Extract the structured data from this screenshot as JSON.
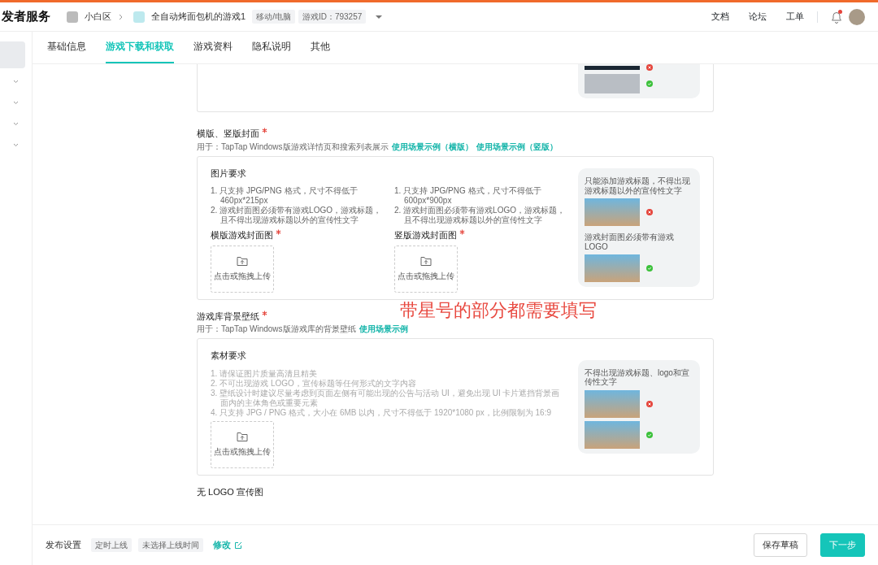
{
  "header": {
    "brand": "发者服务",
    "breadcrumb": [
      {
        "label": "小白区",
        "kind": "area"
      },
      {
        "label": "全自动烤面包机的游戏1",
        "kind": "game"
      }
    ],
    "tags": [
      "移动/电脑",
      "游戏ID：793257"
    ],
    "nav": [
      "文档",
      "论坛",
      "工单"
    ],
    "notification": true
  },
  "sidebar": {
    "items": [
      {
        "kind": "block",
        "selected": true
      },
      {
        "kind": "group",
        "selected": false
      },
      {
        "kind": "group",
        "selected": false
      },
      {
        "kind": "group",
        "selected": false
      },
      {
        "kind": "group",
        "selected": false
      }
    ]
  },
  "tabs": [
    {
      "label": "基础信息",
      "selected": false
    },
    {
      "label": "游戏下载和获取",
      "selected": true
    },
    {
      "label": "游戏资料",
      "selected": false
    },
    {
      "label": "隐私说明",
      "selected": false
    },
    {
      "label": "其他",
      "selected": false
    }
  ],
  "sections": [
    {
      "kind": "partial",
      "examples": [
        {
          "ok": false,
          "cut": true
        },
        {
          "ok": true
        }
      ]
    },
    {
      "kind": "covers",
      "title": "横版、竖版封面",
      "required": true,
      "description": "用于：TapTap Windows版游戏详情页和搜索列表展示",
      "links": [
        "使用场景示例（横版）",
        "使用场景示例（竖版）"
      ],
      "heading": "图片要求",
      "columns": [
        {
          "rules": [
            "1. 只支持 JPG/PNG 格式，尺寸不得低于 460px*215px",
            "2. 游戏封面图必须带有游戏LOGO，游戏标题，且不得出现游戏标题以外的宣传性文字"
          ],
          "label": "横版游戏封面图",
          "required": true,
          "upload": "点击或拖拽上传"
        },
        {
          "rules": [
            "1. 只支持 JPG/PNG 格式，尺寸不得低于 600px*900px",
            "2. 游戏封面图必须带有游戏LOGO，游戏标题，且不得出现游戏标题以外的宣传性文字"
          ],
          "label": "竖版游戏封面图",
          "required": true,
          "upload": "点击或拖拽上传"
        }
      ],
      "examples": [
        {
          "caption": "只能添加游戏标题，不得出现游戏标题以外的宣传性文字",
          "ok": false
        },
        {
          "caption": "游戏封面图必须带有游戏LOGO",
          "ok": true
        }
      ]
    },
    {
      "kind": "wallpaper",
      "title": "游戏库背景壁纸",
      "required": true,
      "description": "用于：TapTap Windows版游戏库的背景壁纸",
      "links": [
        "使用场景示例"
      ],
      "heading": "素材要求",
      "columns": [
        {
          "rules": [
            "1. 请保证图片质量高清且精美",
            "2. 不可出现游戏 LOGO，宣传标题等任何形式的文字内容",
            "3. 壁纸设计时建议尽量考虑到页面左侧有可能出现的公告与活动 UI，避免出现 UI 卡片遮挡背景画面内的主体角色或重要元素",
            "4. 只支持 JPG / PNG 格式，大小在 6MB 以内，尺寸不得低于 1920*1080 px，比例限制为 16:9"
          ],
          "upload": "点击或拖拽上传"
        }
      ],
      "examples": [
        {
          "caption": "不得出现游戏标题、logo和宣传性文字",
          "ok": false
        },
        {
          "ok": true
        }
      ]
    },
    {
      "kind": "title_only",
      "title": "无 LOGO 宣传图",
      "required": false
    }
  ],
  "annotation": "带星号的部分都需要填写",
  "footer": {
    "label": "发布设置",
    "tags": [
      "定时上线",
      "未选择上线时间"
    ],
    "link": "修改",
    "buttons": [
      {
        "label": "保存草稿",
        "kind": "secondary"
      },
      {
        "label": "下一步",
        "kind": "primary"
      }
    ]
  }
}
